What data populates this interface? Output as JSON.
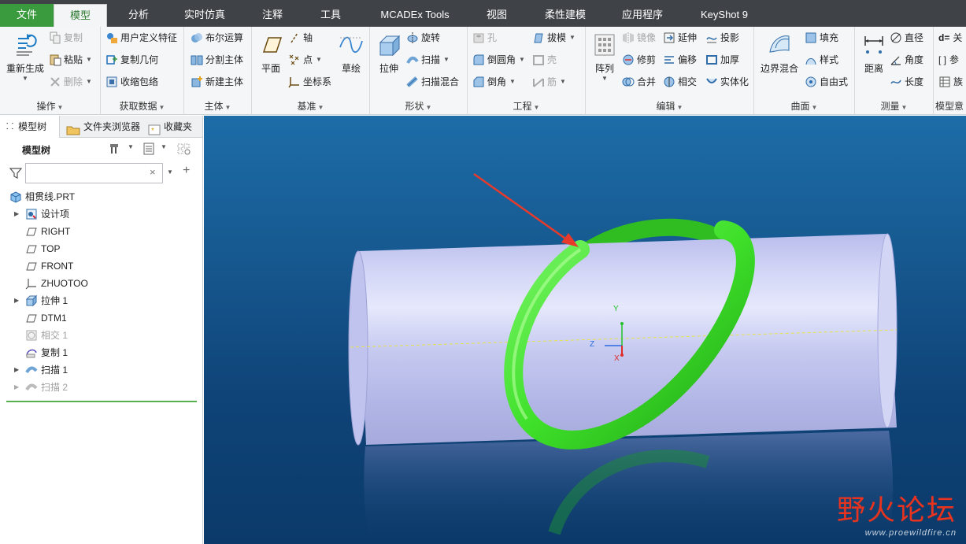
{
  "tabs": {
    "file": "文件",
    "model": "模型",
    "analysis": "分析",
    "simulation": "实时仿真",
    "annotate": "注释",
    "tools": "工具",
    "mcadex": "MCADEx Tools",
    "view": "视图",
    "flexible": "柔性建模",
    "apps": "应用程序",
    "keyshot": "KeyShot 9"
  },
  "ribbon": {
    "ops": {
      "regen": "重新生成",
      "copy": "复制",
      "paste": "粘贴",
      "delete": "删除",
      "label": "操作"
    },
    "getdata": {
      "udf": "用户定义特征",
      "copygeom": "复制几何",
      "shrinkwrap": "收缩包络",
      "label": "获取数据"
    },
    "body": {
      "boolean": "布尔运算",
      "split": "分割主体",
      "newbody": "新建主体",
      "label": "主体"
    },
    "datum": {
      "plane": "平面",
      "axis": "轴",
      "point": "点",
      "csys": "坐标系",
      "sketch": "草绘",
      "label": "基准"
    },
    "shapes": {
      "extrude": "拉伸",
      "revolve": "旋转",
      "sweep": "扫描",
      "sweptblend": "扫描混合",
      "label": "形状"
    },
    "engineering": {
      "hole": "孔",
      "round": "倒圆角",
      "chamfer": "倒角",
      "draft": "拔模",
      "shell": "壳",
      "rib": "筋",
      "label": "工程"
    },
    "editing": {
      "pattern": "阵列",
      "mirror": "镜像",
      "trim": "修剪",
      "merge": "合并",
      "extend": "延伸",
      "offset": "偏移",
      "intersect": "相交",
      "project": "投影",
      "thicken": "加厚",
      "solidify": "实体化",
      "label": "编辑"
    },
    "surfaces": {
      "boundary": "边界混合",
      "fill": "填充",
      "style": "样式",
      "freestyle": "自由式",
      "label": "曲面"
    },
    "measure": {
      "distance": "距离",
      "diameter": "直径",
      "angle": "角度",
      "length": "长度",
      "label": "测量"
    },
    "intent": {
      "relations": "关",
      "params": "参",
      "family": "族",
      "label": "模型意"
    }
  },
  "panel": {
    "tabs": {
      "model_tree": "模型树",
      "folder": "文件夹浏览器",
      "favorites": "收藏夹"
    },
    "header": "模型树",
    "search_value": "",
    "tree": [
      {
        "label": "相贯线.PRT"
      },
      {
        "label": "设计项"
      },
      {
        "label": "RIGHT"
      },
      {
        "label": "TOP"
      },
      {
        "label": "FRONT"
      },
      {
        "label": "ZHUOTOO"
      },
      {
        "label": "拉伸 1"
      },
      {
        "label": "DTM1"
      },
      {
        "label": "相交 1"
      },
      {
        "label": "复制 1"
      },
      {
        "label": "扫描 1"
      },
      {
        "label": "扫描 2"
      }
    ]
  },
  "viewport": {
    "csys_y": "Y",
    "csys_z": "Z",
    "csys_x": "X",
    "watermark": "野火论坛",
    "watermark_url": "www.proewildfire.cn"
  },
  "colors": {
    "file_tab": "#3a9a3e",
    "active_tab_text": "#2b7a2f",
    "cylinder": "#c5caef",
    "ring": "#3fe02a",
    "arrow": "#e83a2a",
    "bg_top": "#1d6da8",
    "bg_bottom": "#0b3a6a"
  }
}
